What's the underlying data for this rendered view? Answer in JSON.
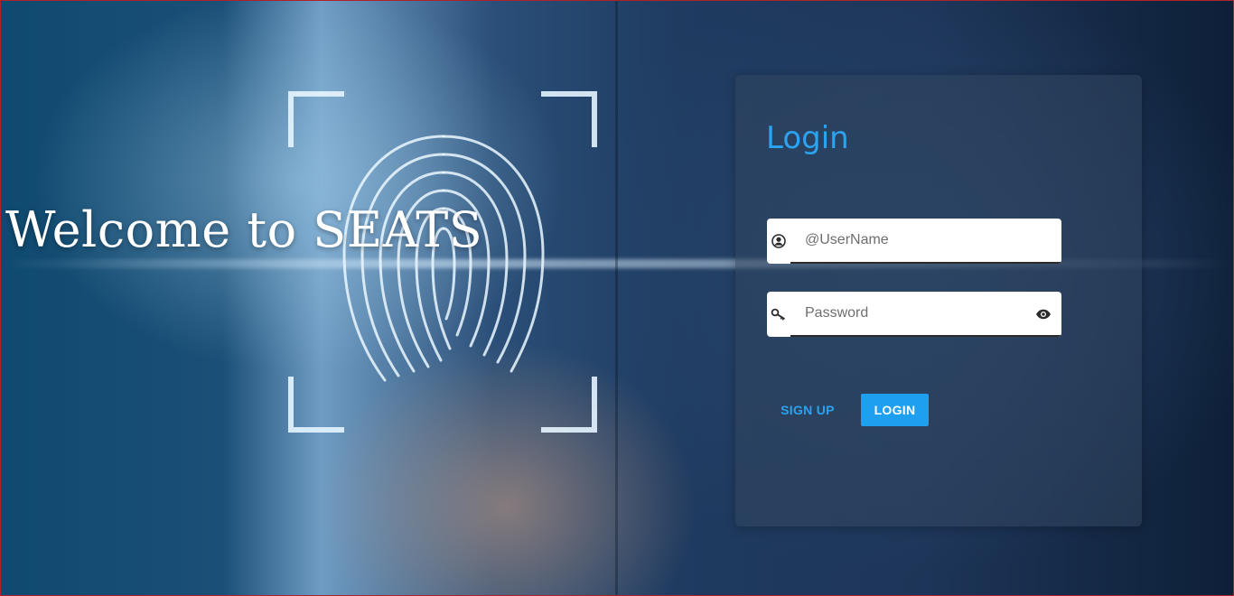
{
  "hero": {
    "welcome_text": "Welcome to SEATS"
  },
  "login": {
    "title": "Login",
    "username_placeholder": "@UserName",
    "password_placeholder": "Password",
    "signup_label": "SIGN UP",
    "login_label": "LOGIN"
  },
  "icons": {
    "username": "user-icon",
    "password": "key-icon",
    "show_password": "eye-icon"
  },
  "colors": {
    "accent": "#2ba3f0",
    "login_button": "#1e9ff0",
    "welcome_text": "#ffffff"
  }
}
